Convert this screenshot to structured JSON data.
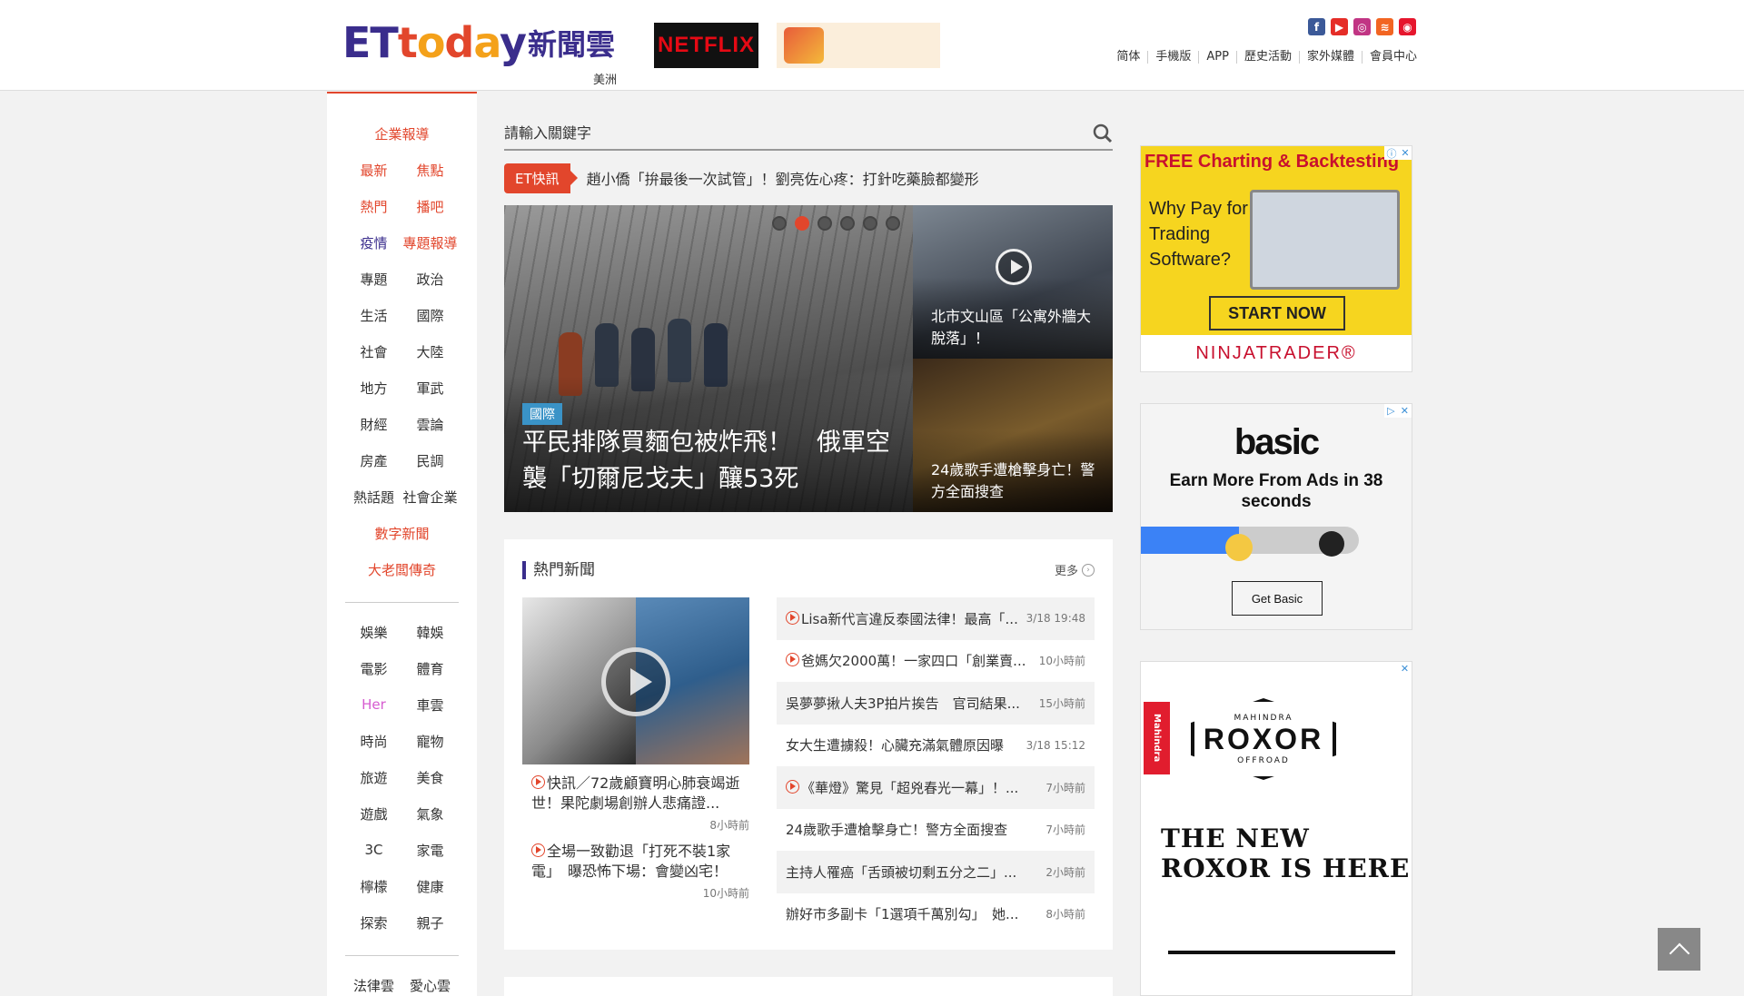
{
  "header": {
    "logo_text": "ETtoday新聞雲",
    "logo_cn": "新聞雲",
    "region": "美洲",
    "netflix_label": "NETFLIX",
    "social": [
      {
        "name": "facebook-icon",
        "glyph": "f"
      },
      {
        "name": "youtube-icon",
        "glyph": "▶"
      },
      {
        "name": "instagram-icon",
        "glyph": "◎"
      },
      {
        "name": "rss-icon",
        "glyph": "≋"
      },
      {
        "name": "weibo-icon",
        "glyph": "◉"
      }
    ],
    "toplinks": [
      "简体",
      "手機版",
      "APP",
      "歷史活動",
      "家外媒體",
      "會員中心"
    ]
  },
  "nav": {
    "r1": "企業報導",
    "r2": [
      "最新",
      "焦點"
    ],
    "r3": [
      "熱門",
      "播吧"
    ],
    "r4": [
      "疫情",
      "專題報導"
    ],
    "r5": [
      "專題",
      "政治"
    ],
    "r6": [
      "生活",
      "國際"
    ],
    "r7": [
      "社會",
      "大陸"
    ],
    "r8": [
      "地方",
      "軍武"
    ],
    "r9": [
      "財經",
      "雲論"
    ],
    "r10": [
      "房產",
      "民調"
    ],
    "r11": [
      "熱話題",
      "社會企業"
    ],
    "r12": "數字新聞",
    "r13": "大老闆傳奇",
    "r14": [
      "娛樂",
      "韓娛"
    ],
    "r15": [
      "電影",
      "體育"
    ],
    "r16": [
      "Her",
      "車雲"
    ],
    "r17": [
      "時尚",
      "寵物"
    ],
    "r18": [
      "旅遊",
      "美食"
    ],
    "r19": [
      "遊戲",
      "氣象"
    ],
    "r20": [
      "3C",
      "家電"
    ],
    "r21": [
      "檸檬",
      "健康"
    ],
    "r22": [
      "探索",
      "親子"
    ],
    "r23": [
      "法律雲",
      "愛心雲"
    ]
  },
  "search": {
    "placeholder": "請輸入關鍵字"
  },
  "breaking": {
    "tag": "ET快訊",
    "text": "趙小僑「拚最後一次試管」！劉亮佐心疼：打針吃藥臉都變形"
  },
  "hero": {
    "category": "國際",
    "title": "平民排隊買麵包被炸飛！　俄軍空襲「切爾尼戈夫」釀53死",
    "side": [
      {
        "title": "北市文山區「公寓外牆大脫落」！"
      },
      {
        "title": "24歲歌手遭槍擊身亡！警方全面搜查"
      }
    ]
  },
  "hot": {
    "title": "熱門新聞",
    "more": "更多",
    "left": [
      {
        "title": "快訊／72歲顧寶明心肺衰竭逝世！果陀劇場創辦人悲痛證...",
        "time": "8小時前",
        "video": true
      },
      {
        "title": "全場一致勸退「打死不裝1家電」　曝恐怖下場：會變凶宅！",
        "time": "10小時前",
        "video": true
      }
    ],
    "right": [
      {
        "title": "Lisa新代言違反泰國法律！最高「...",
        "time": "3/18 19:48",
        "video": true
      },
      {
        "title": "爸媽欠2000萬！一家四口「創業賣...",
        "time": "10小時前",
        "video": true
      },
      {
        "title": "吳夢夢揪人夫3P拍片挨告　官司結果...",
        "time": "15小時前",
        "video": false
      },
      {
        "title": "女大生遭擄殺！心臟充滿氣體原因曝",
        "time": "3/18 15:12",
        "video": false
      },
      {
        "title": "《華燈》驚見「超兇春光一幕」！...",
        "time": "7小時前",
        "video": true
      },
      {
        "title": "24歲歌手遭槍擊身亡！警方全面搜查",
        "time": "7小時前",
        "video": false
      },
      {
        "title": "主持人罹癌「舌頭被切剩五分之二」...",
        "time": "2小時前",
        "video": false
      },
      {
        "title": "辦好市多副卡「1選項千萬別勾」　她...",
        "time": "8小時前",
        "video": false
      }
    ]
  },
  "ads": {
    "ad1": {
      "top": "FREE Charting & Backtesting",
      "body": [
        "Why Pay for",
        "Trading",
        "Software?"
      ],
      "cta": "START NOW",
      "brand": "NINJATRADER®"
    },
    "ad2": {
      "logo": "basic",
      "text": "Earn More From Ads in 38 seconds",
      "cta": "Get Basic",
      "progress": 0.45
    },
    "ad3": {
      "side": "Mahindra",
      "brand": "ROXOR",
      "brand_sub": "MAHINDRA",
      "brand_sub2": "OFFROAD",
      "headline": "THE NEW ROXOR IS HERE"
    }
  }
}
